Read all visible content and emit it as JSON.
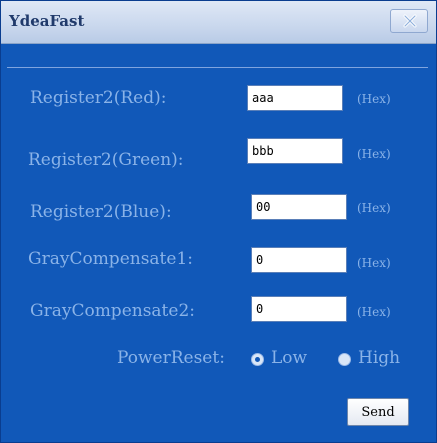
{
  "window": {
    "title": "YdeaFast"
  },
  "rows": [
    {
      "label": "Register2(Red):",
      "value": "aaa",
      "unit": "(Hex)"
    },
    {
      "label": "Register2(Green):",
      "value": "bbb",
      "unit": "(Hex)"
    },
    {
      "label": "Register2(Blue):",
      "value": "00",
      "unit": "(Hex)"
    },
    {
      "label": "GrayCompensate1:",
      "value": "0",
      "unit": "(Hex)"
    },
    {
      "label": "GrayCompensate2:",
      "value": "0",
      "unit": "(Hex)"
    }
  ],
  "power_reset": {
    "label": "PowerReset:",
    "options": [
      "Low",
      "High"
    ],
    "selected": "Low"
  },
  "send_label": "Send",
  "icons": {
    "close": "close-icon"
  },
  "colors": {
    "background": "#1158b8",
    "label": "#8ab3e8",
    "titlebar": "#cbd9ee"
  }
}
